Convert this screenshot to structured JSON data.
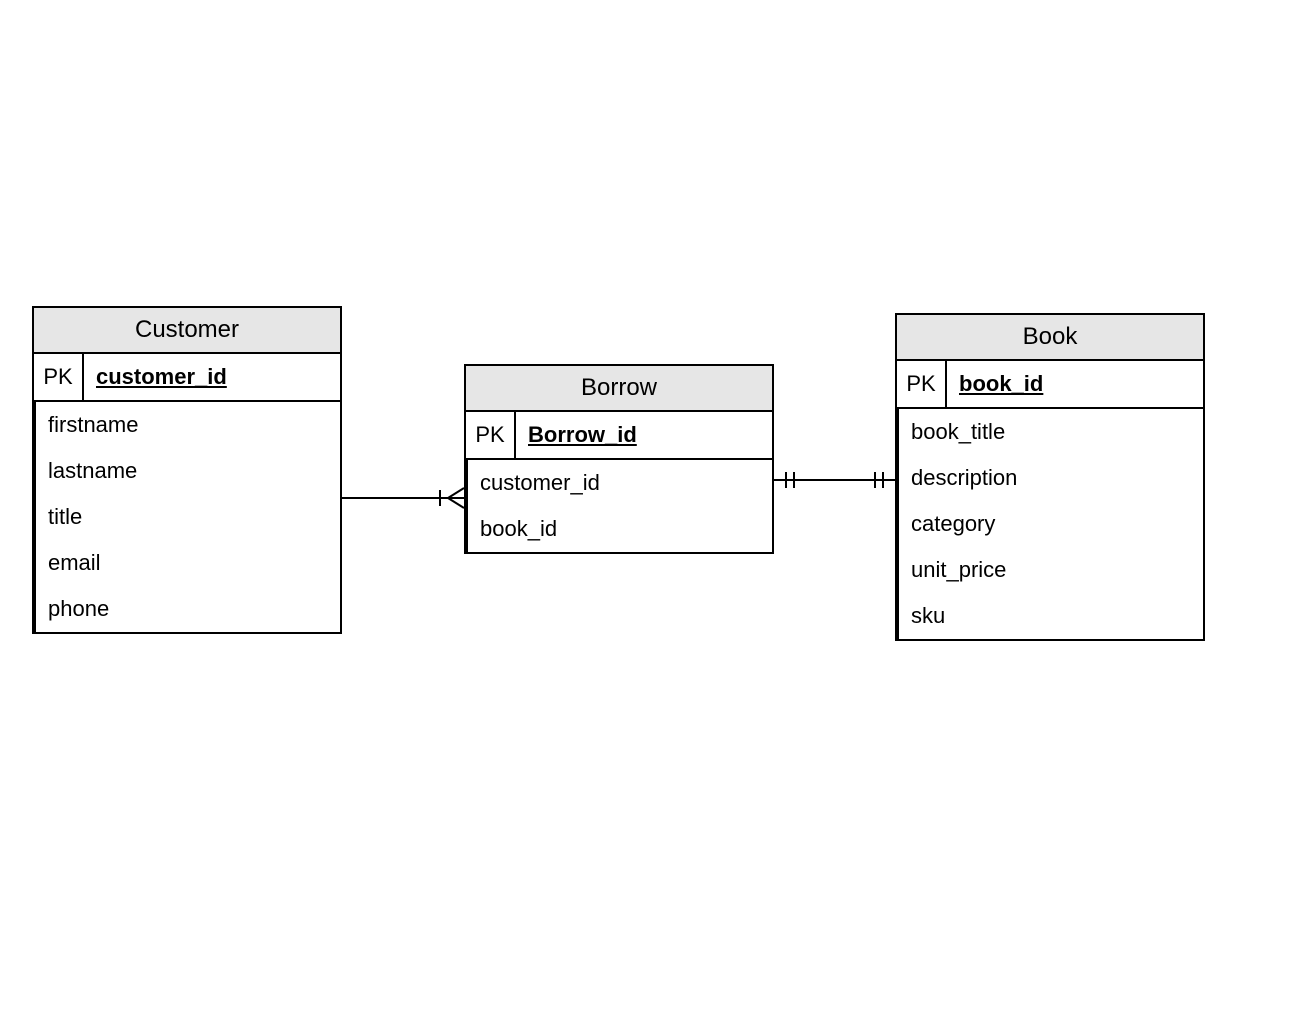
{
  "entities": {
    "customer": {
      "title": "Customer",
      "pk_label": "PK",
      "pk_attr": "customer_id",
      "attrs": [
        "firstname",
        "lastname",
        "title",
        "email",
        "phone"
      ]
    },
    "borrow": {
      "title": "Borrow",
      "pk_label": "PK",
      "pk_attr": "Borrow_id",
      "attrs": [
        "customer_id",
        "book_id"
      ]
    },
    "book": {
      "title": "Book",
      "pk_label": "PK",
      "pk_attr": "book_id",
      "attrs": [
        "book_title",
        "description",
        "category",
        "unit_price",
        "sku"
      ]
    }
  },
  "relationships": [
    {
      "from": "customer",
      "to": "borrow",
      "type": "one-to-many"
    },
    {
      "from": "borrow",
      "to": "book",
      "type": "one-to-one"
    }
  ]
}
